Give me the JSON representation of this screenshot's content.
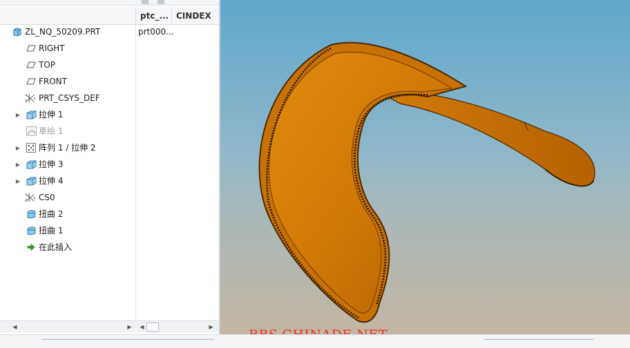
{
  "tree": {
    "columns": [
      "ptc_...",
      "CINDEX"
    ],
    "root": {
      "label": "ZL_NQ_50209.PRT",
      "value": "prt000..."
    },
    "items": [
      {
        "label": "RIGHT",
        "icon": "datum-plane-icon"
      },
      {
        "label": "TOP",
        "icon": "datum-plane-icon"
      },
      {
        "label": "FRONT",
        "icon": "datum-plane-icon"
      },
      {
        "label": "PRT_CSYS_DEF",
        "icon": "coordinate-system-icon"
      },
      {
        "label": "拉伸 1",
        "icon": "extrude-icon"
      },
      {
        "label": "草绘 1",
        "icon": "sketch-icon"
      },
      {
        "label": "阵列 1 / 拉伸 2",
        "icon": "pattern-icon"
      },
      {
        "label": "拉伸 3",
        "icon": "extrude-icon"
      },
      {
        "label": "拉伸 4",
        "icon": "extrude-icon"
      },
      {
        "label": "CS0",
        "icon": "coordinate-system-icon"
      },
      {
        "label": "扭曲 2",
        "icon": "warp-icon"
      },
      {
        "label": "扭曲 1",
        "icon": "warp-icon"
      },
      {
        "label": "在此插入",
        "icon": "insert-here-icon"
      }
    ]
  },
  "watermark": "BBS.CHINADE.NET",
  "colors": {
    "part": "#d87e08",
    "edge": "#6b3a06",
    "bg_top": "#5fa8cd",
    "bg_bottom": "#c4b6a4",
    "watermark": "#e8322a"
  }
}
